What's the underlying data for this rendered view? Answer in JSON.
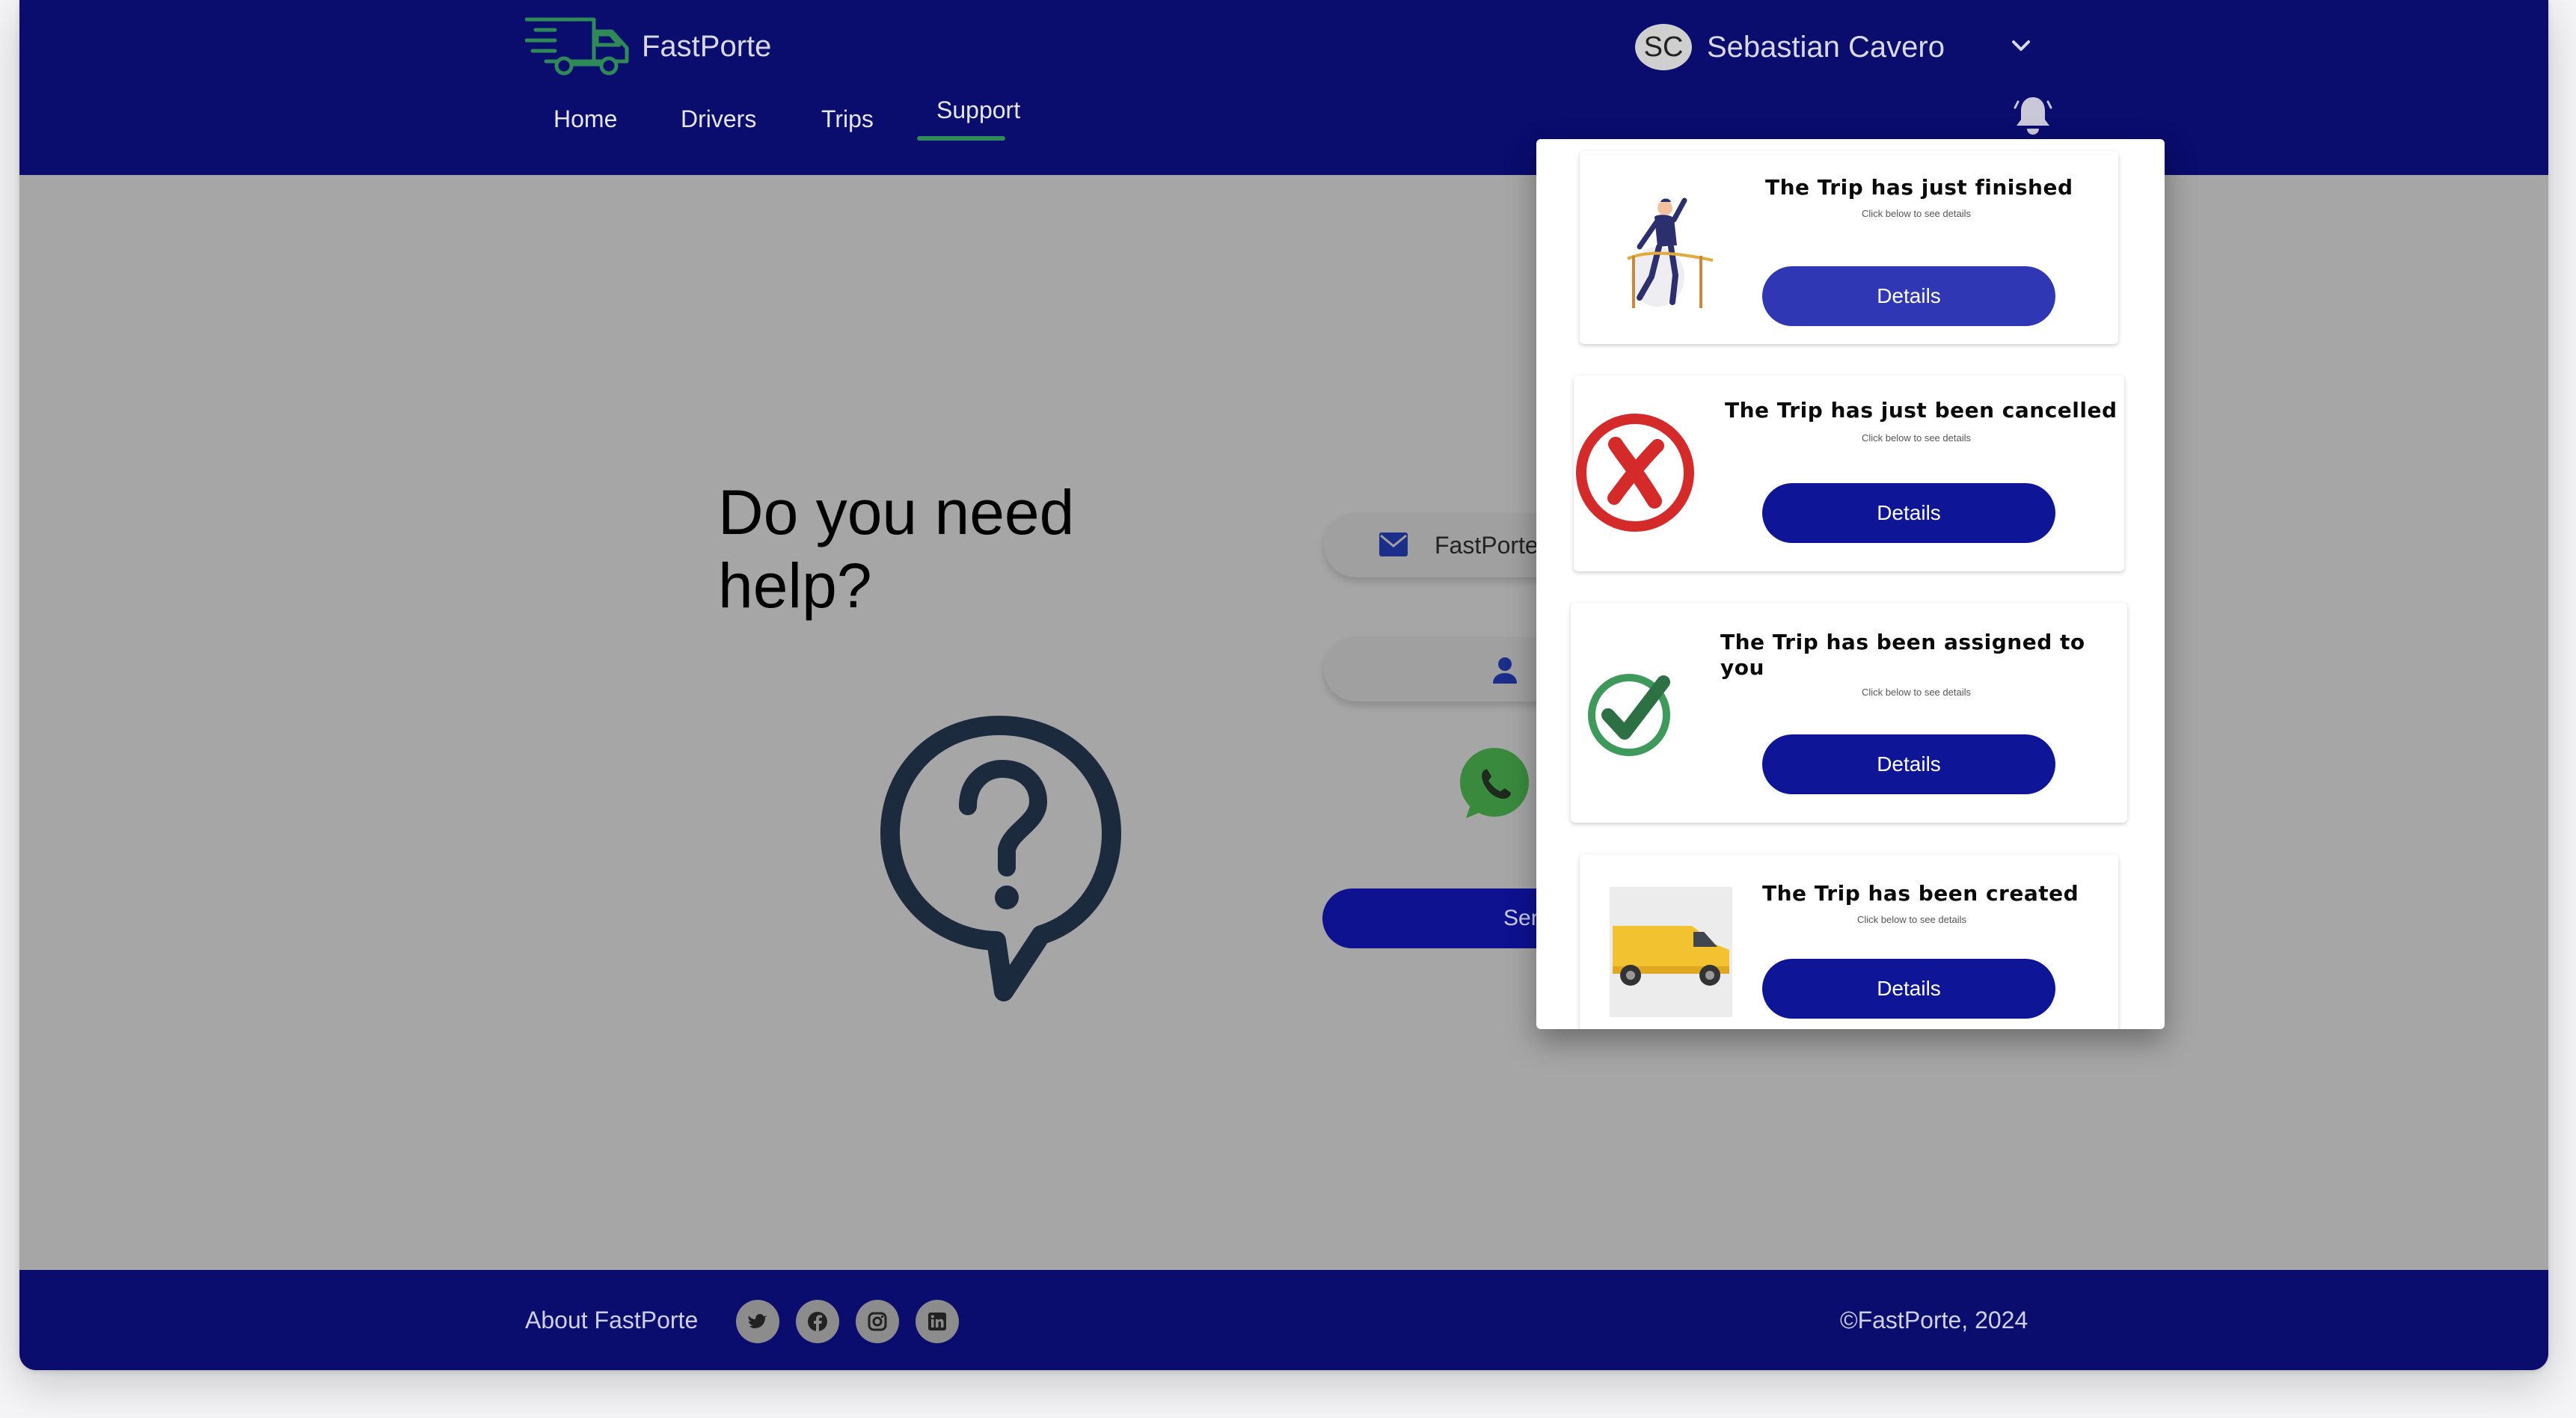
{
  "header": {
    "brand": "FastPorte",
    "nav": [
      "Home",
      "Drivers",
      "Trips",
      "Support"
    ],
    "active_nav": "Support",
    "user_initials": "SC",
    "user_name": "Sebastian Cavero"
  },
  "main": {
    "title": "Do you need help?",
    "email_text": "FastPorte",
    "phone_text": "+",
    "send_label": "Send"
  },
  "notifications": [
    {
      "title": "The Trip has just finished",
      "subtitle": "Click below to see details",
      "button": "Details",
      "icon": "person-finish-line-illustration"
    },
    {
      "title": "The Trip has just been cancelled",
      "subtitle": "Click below to see details",
      "button": "Details",
      "icon": "red-x-circle-icon"
    },
    {
      "title": "The Trip has been assigned to you",
      "subtitle": "Click below to see details",
      "button": "Details",
      "icon": "green-check-circle-icon"
    },
    {
      "title": "The Trip has been created",
      "subtitle": "Click below to see details",
      "button": "Details",
      "icon": "yellow-van-image"
    }
  ],
  "footer": {
    "about": "About FastPorte",
    "social": [
      "twitter-icon",
      "facebook-icon",
      "instagram-icon",
      "linkedin-icon"
    ],
    "copyright": "©FastPorte, 2024"
  },
  "colors": {
    "header_bg": "#0a0c6e",
    "accent_green": "#2f8a57",
    "button_blue": "#0e1597",
    "overlay_gray": "#a6a6a6"
  }
}
